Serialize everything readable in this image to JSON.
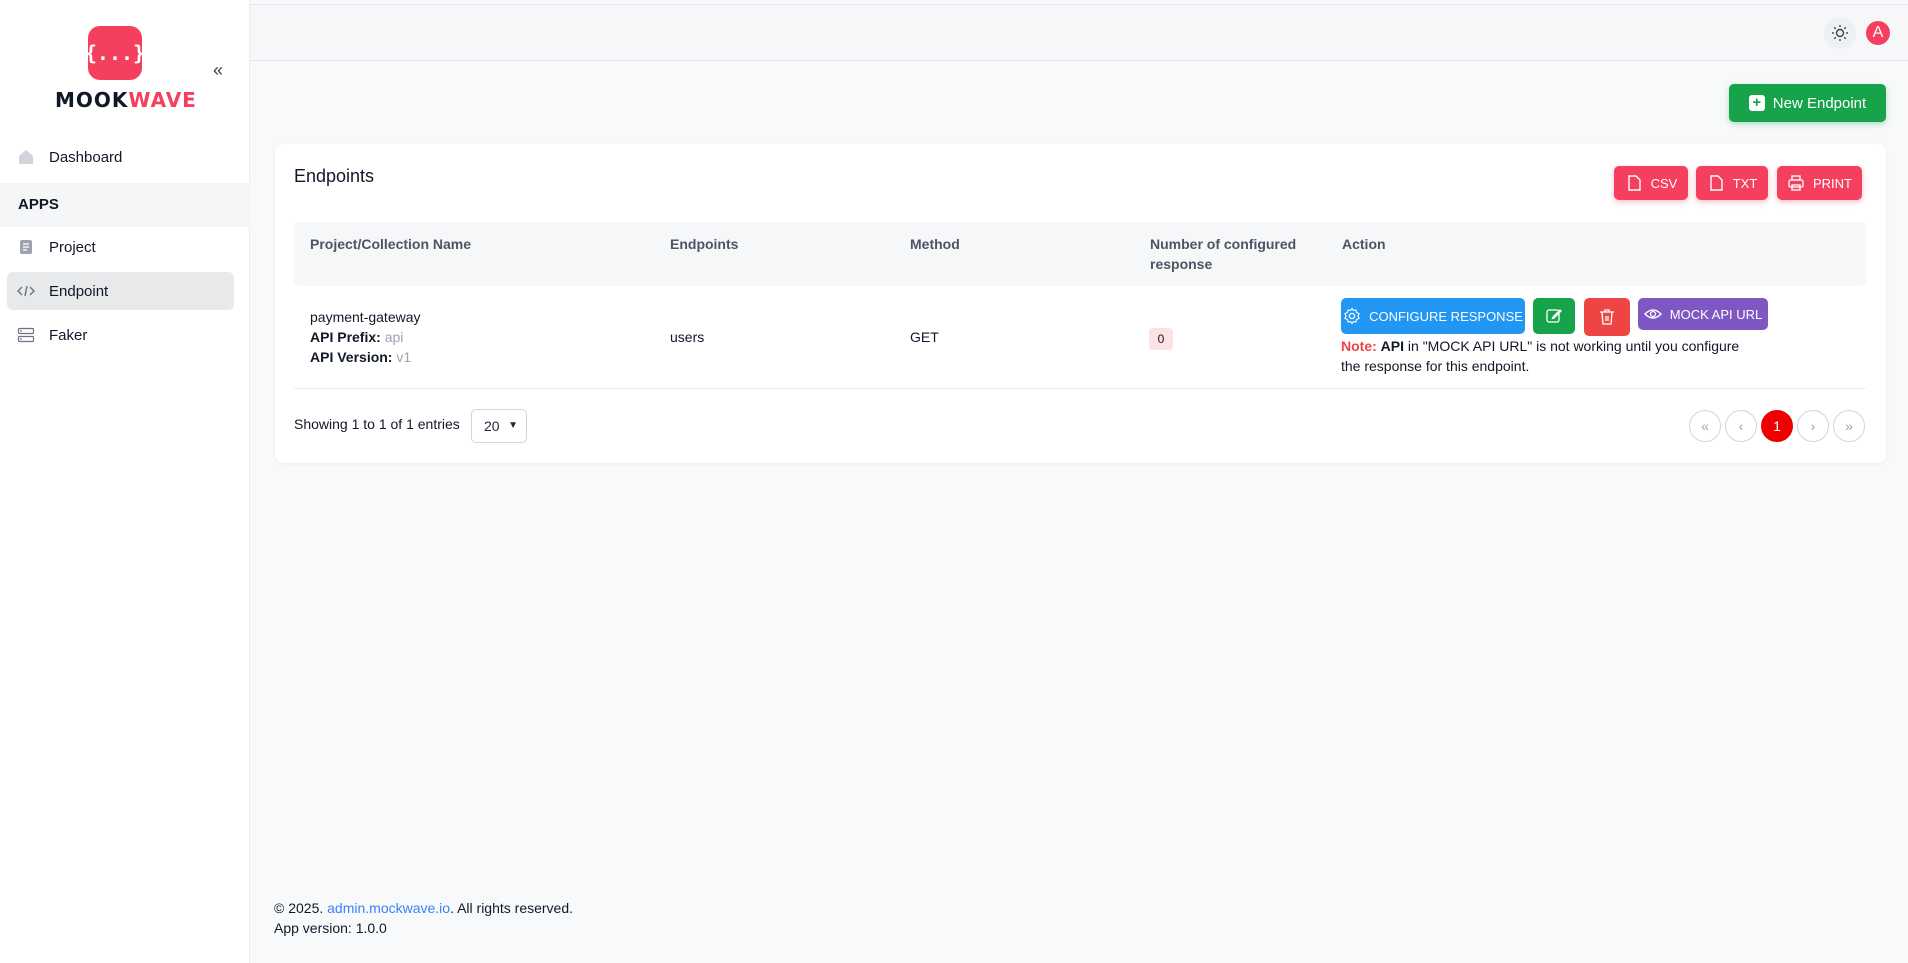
{
  "brand": {
    "logo_glyph": "{...}",
    "name_part1": "MOOK",
    "name_part2": "WAVE"
  },
  "sidebar": {
    "items": [
      {
        "label": "Dashboard"
      },
      {
        "label": "Project"
      },
      {
        "label": "Endpoint"
      },
      {
        "label": "Faker"
      }
    ],
    "section_label": "APPS"
  },
  "header": {
    "avatar_letter": "A"
  },
  "toolbar": {
    "new_endpoint_label": "New Endpoint"
  },
  "card": {
    "title": "Endpoints",
    "export": {
      "csv": "CSV",
      "txt": "TXT",
      "print": "PRINT"
    }
  },
  "table": {
    "headers": [
      "Project/Collection Name",
      "Endpoints",
      "Method",
      "Number of configured",
      "response",
      "Action"
    ],
    "rows": [
      {
        "project": "payment-gateway",
        "prefix_label": "API Prefix:",
        "prefix_value": "api",
        "version_label": "API Version:",
        "version_value": "v1",
        "endpoint": "users",
        "method": "GET",
        "configured": "0",
        "configure_label": "CONFIGURE RESPONSE",
        "mock_label": "MOCK API URL",
        "note_label": "Note:",
        "note_bold": "API",
        "note_text_1": " in \"MOCK API URL\" is not working until you configure",
        "note_text_2": "the response for this endpoint."
      }
    ]
  },
  "pagination": {
    "showing": "Showing 1 to 1 of 1 entries",
    "page_size": "20",
    "current_page": "1"
  },
  "footer": {
    "copyright_prefix": "© 2025. ",
    "link_text": "admin.mockwave.io",
    "copyright_suffix": ". All rights reserved.",
    "version": "App version: 1.0.0"
  },
  "colors": {
    "accent": "#f43f5e",
    "success": "#16a34a",
    "info": "#2196f3",
    "purple": "#7e57c2",
    "danger": "#ef4444"
  }
}
